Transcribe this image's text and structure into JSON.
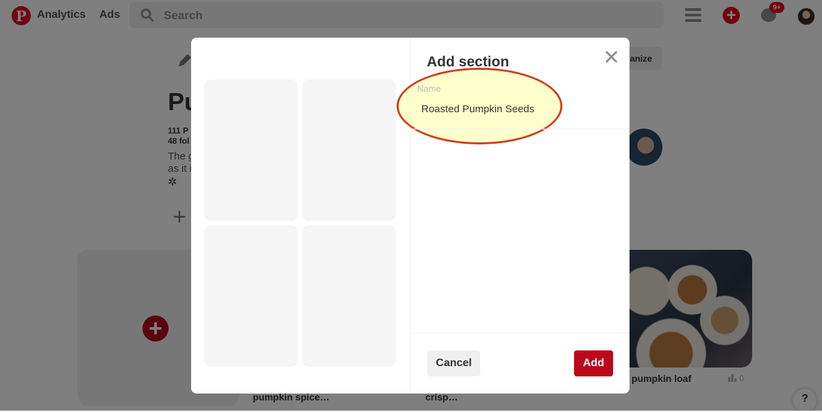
{
  "topbar": {
    "logo": "P",
    "nav": [
      "Analytics",
      "Ads"
    ],
    "search_placeholder": "Search",
    "notification_count": "9+"
  },
  "board": {
    "title": "Pu",
    "stats_lines": [
      "111 P",
      "48 fol"
    ],
    "description_lines": [
      "The g",
      "as it i"
    ],
    "organize_label": "anize"
  },
  "pins": [
    {
      "title": "pumpkin spice…"
    },
    {
      "title": "crisp…"
    },
    {
      "title": "pumpkin loaf",
      "stat": "0"
    }
  ],
  "help_label": "?",
  "modal": {
    "title": "Add section",
    "name_label": "Name",
    "name_value": "Roasted Pumpkin Seeds",
    "cancel_label": "Cancel",
    "add_label": "Add"
  },
  "colors": {
    "brand_red": "#e60023",
    "button_red": "#bd081c",
    "highlight_fill": "#ffffcc",
    "highlight_stroke": "#c8421c"
  }
}
